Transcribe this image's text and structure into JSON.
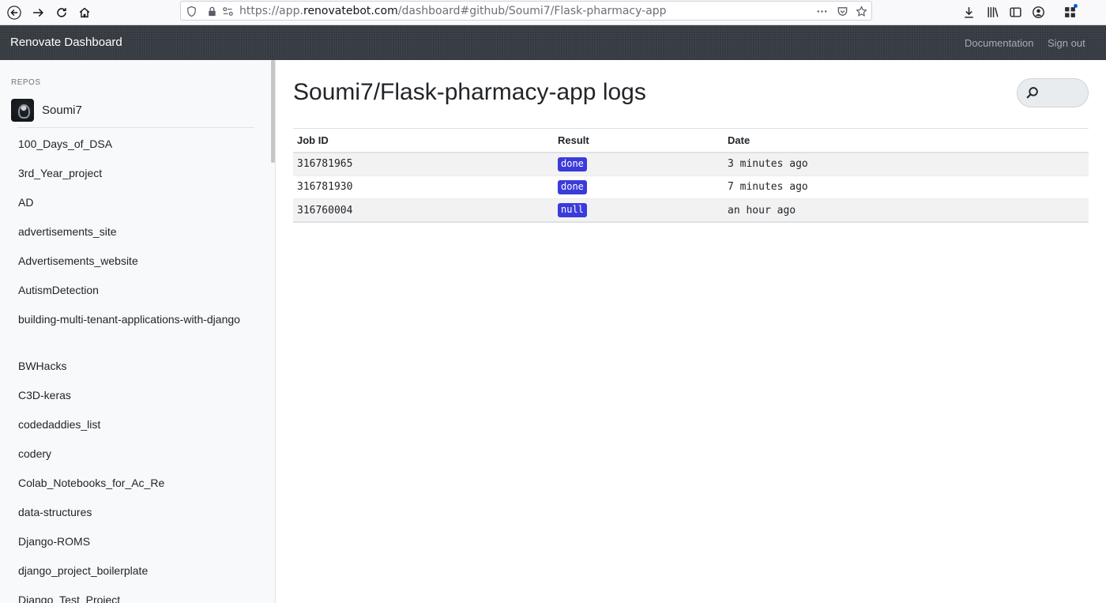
{
  "browser": {
    "url_prefix": "https://app.",
    "url_host": "renovatebot.com",
    "url_path": "/dashboard#github/Soumi7/Flask-pharmacy-app"
  },
  "navbar": {
    "brand": "Renovate Dashboard",
    "documentation": "Documentation",
    "sign_out": "Sign out"
  },
  "sidebar": {
    "heading": "REPOS",
    "org_name": "Soumi7",
    "repos": [
      "100_Days_of_DSA",
      "3rd_Year_project",
      "AD",
      "advertisements_site",
      "Advertisements_website",
      "AutismDetection",
      "building-multi-tenant-applications-with-django",
      "BWHacks",
      "C3D-keras",
      "codedaddies_list",
      "codery",
      "Colab_Notebooks_for_Ac_Re",
      "data-structures",
      "Django-ROMS",
      "django_project_boilerplate",
      "Django_Test_Project"
    ]
  },
  "main": {
    "title": "Soumi7/Flask-pharmacy-app logs",
    "columns": [
      "Job ID",
      "Result",
      "Date"
    ],
    "rows": [
      {
        "job_id": "316781965",
        "result": "done",
        "date": "3 minutes ago"
      },
      {
        "job_id": "316781930",
        "result": "done",
        "date": "7 minutes ago"
      },
      {
        "job_id": "316760004",
        "result": "null",
        "date": "an hour ago"
      }
    ]
  },
  "colors": {
    "navbar": "#343a40",
    "badge": "#3b3bdb",
    "sidebar": "#f8f9fa"
  },
  "icons": [
    "back-arrow-icon",
    "forward-arrow-icon",
    "reload-icon",
    "home-icon",
    "shield-icon",
    "lock-icon",
    "permissions-icon",
    "more-icon",
    "pocket-icon",
    "bookmark-star-icon",
    "download-icon",
    "library-icon",
    "sidebar-icon",
    "account-icon",
    "extensions-icon",
    "search-icon"
  ]
}
